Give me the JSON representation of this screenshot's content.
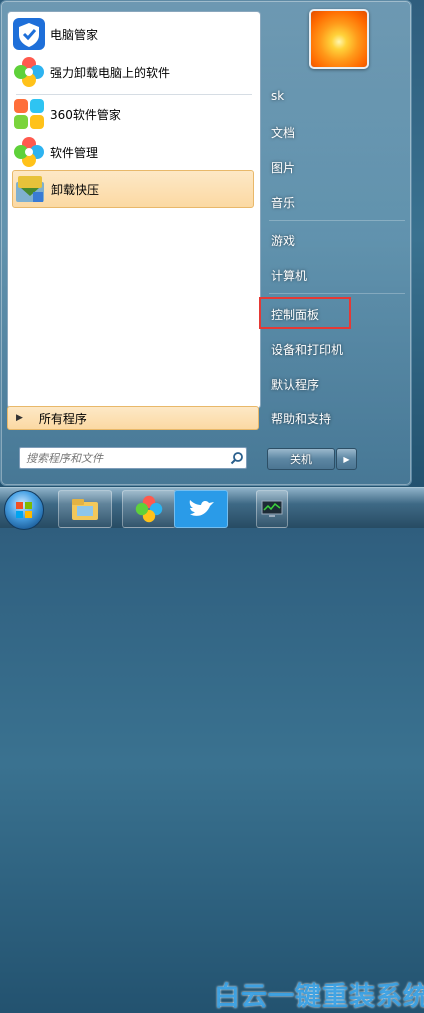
{
  "start_menu": {
    "programs": [
      {
        "label": "电脑管家",
        "icon": "tencent-pc-manager-icon"
      },
      {
        "label": "强力卸载电脑上的软件",
        "icon": "clover-icon"
      },
      {
        "label": "360软件管家",
        "icon": "360-software-manager-icon"
      },
      {
        "label": "软件管理",
        "icon": "clover-icon"
      },
      {
        "label": "卸载快压",
        "icon": "kuaiya-uninstall-icon"
      }
    ],
    "all_programs_label": "所有程序",
    "search": {
      "placeholder": "搜索程序和文件"
    },
    "right_links": {
      "user": "sk",
      "documents": "文档",
      "pictures": "图片",
      "music": "音乐",
      "games": "游戏",
      "computer": "计算机",
      "control_panel": "控制面板",
      "devices_printers": "设备和打印机",
      "default_programs": "默认程序",
      "help_support": "帮助和支持"
    },
    "shutdown_label": "关机"
  },
  "watermark": "白云一键重装系统",
  "colors": {
    "highlight_box": "#e53935",
    "selected_item": "#fbd9a3"
  }
}
